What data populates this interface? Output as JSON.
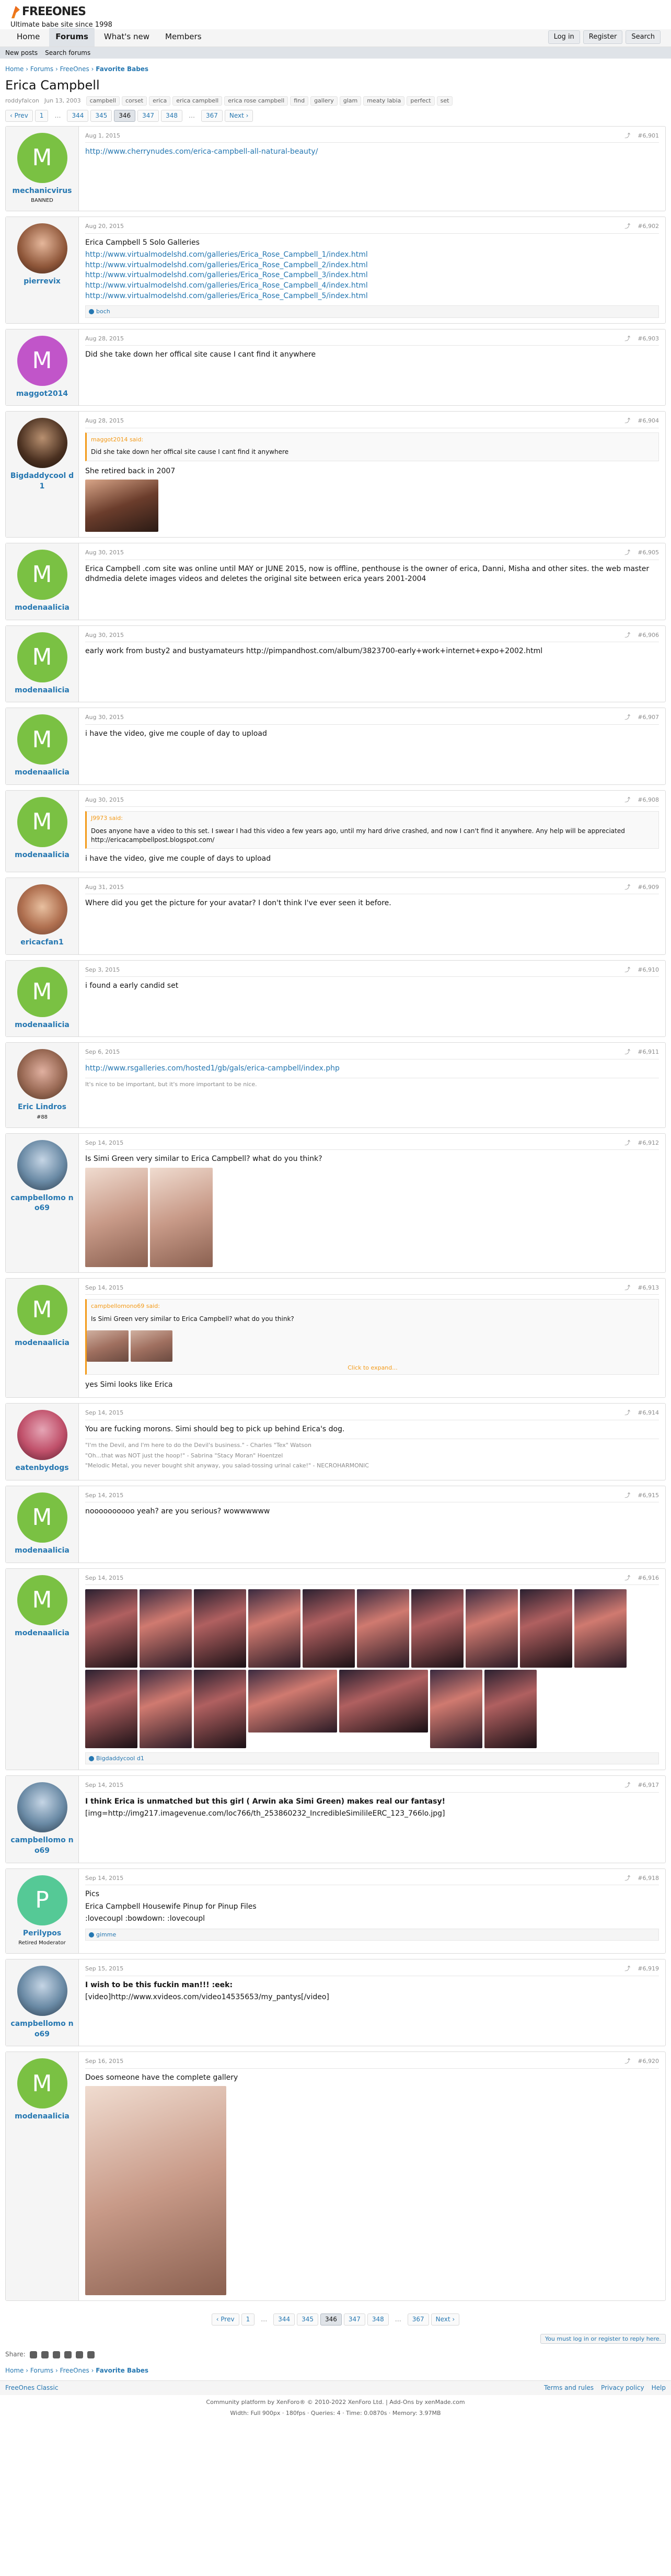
{
  "header": {
    "logo": "FREEONES",
    "tagline": "Ultimate babe site since 1998",
    "tabs": [
      "Home",
      "Forums",
      "What's new",
      "Members"
    ],
    "login": "Log in",
    "register": "Register",
    "search": "Search",
    "sub": [
      "New posts",
      "Search forums"
    ]
  },
  "breadcrumb": [
    "Home",
    "Forums",
    "FreeOnes",
    "Favorite Babes"
  ],
  "thread": {
    "title": "Erica Campbell",
    "author": "roddyfalcon",
    "date": "Jun 13, 2003",
    "tags": [
      "campbell",
      "corset",
      "erica",
      "erica campbell",
      "erica rose campbell",
      "find",
      "gallery",
      "glam",
      "meaty labia",
      "perfect",
      "set"
    ]
  },
  "pager": {
    "prev": "Prev",
    "pages": [
      "1",
      "…",
      "344",
      "345",
      "346",
      "347",
      "348",
      "…",
      "367"
    ],
    "current": "346",
    "next": "Next"
  },
  "posts": [
    {
      "user": "mechanicvirus",
      "title": "BANNED",
      "date": "Aug 1, 2015",
      "num": "#6,901",
      "body": [
        "http://www.cherrynudes.com/erica-campbell-all-natural-beauty/"
      ]
    },
    {
      "user": "pierrevix",
      "title": "",
      "date": "Aug 20, 2015",
      "num": "#6,902",
      "body": [
        "Erica Campbell 5 Solo Galleries",
        "http://www.virtualmodelshd.com/galleries/Erica_Rose_Campbell_1/index.html",
        "http://www.virtualmodelshd.com/galleries/Erica_Rose_Campbell_2/index.html",
        "http://www.virtualmodelshd.com/galleries/Erica_Rose_Campbell_3/index.html",
        "http://www.virtualmodelshd.com/galleries/Erica_Rose_Campbell_4/index.html",
        "http://www.virtualmodelshd.com/galleries/Erica_Rose_Campbell_5/index.html"
      ],
      "likes": "boch"
    },
    {
      "user": "maggot2014",
      "title": "",
      "date": "Aug 28, 2015",
      "num": "#6,903",
      "body": [
        "Did she take down her offical site cause I cant find it anywhere"
      ]
    },
    {
      "user": "Bigdaddycool d1",
      "title": "",
      "date": "Aug 28, 2015",
      "num": "#6,904",
      "quote": {
        "head": "maggot2014 said:",
        "body": "Did she take down her offical site cause I cant find it anywhere"
      },
      "body": [
        "She retired back in 2007"
      ]
    },
    {
      "user": "modenaalicia",
      "title": "",
      "date": "Aug 30, 2015",
      "num": "#6,905",
      "body": [
        "Erica Campbell .com site was online until MAY or JUNE 2015, now is offline, penthouse is the owner of erica, Danni, Misha and other sites. the web master dhdmedia delete images videos and deletes the original site between erica years 2001-2004"
      ]
    },
    {
      "user": "modenaalicia",
      "title": "",
      "date": "Aug 30, 2015",
      "num": "#6,906",
      "body": [
        "early work from busty2 and bustyamateurs http://pimpandhost.com/album/3823700-early+work+internet+expo+2002.html"
      ]
    },
    {
      "user": "modenaalicia",
      "title": "",
      "date": "Aug 30, 2015",
      "num": "#6,907",
      "body": [
        "i have the video, give me couple of day to upload"
      ]
    },
    {
      "user": "modenaalicia",
      "title": "",
      "date": "Aug 30, 2015",
      "num": "#6,908",
      "quote": {
        "head": "J9973 said:",
        "body": "Does anyone have a video to this set. I swear I had this video a few years ago, until my hard drive crashed, and now I can't find it anywhere. Any help will be appreciated http://ericacampbellpost.blogspot.com/"
      },
      "body": [
        "i have the video, give me couple of days to upload"
      ]
    },
    {
      "user": "ericacfan1",
      "title": "",
      "date": "Aug 31, 2015",
      "num": "#6,909",
      "body": [
        "Where did you get the picture for your avatar? I don't think I've ever seen it before."
      ]
    },
    {
      "user": "modenaalicia",
      "title": "",
      "date": "Sep 3, 2015",
      "num": "#6,910",
      "body": [
        "i found a early candid set"
      ]
    },
    {
      "user": "Eric Lindros",
      "title": "#88",
      "date": "Sep 6, 2015",
      "num": "#6,911",
      "body": [
        "http://www.rsgalleries.com/hosted1/gb/gals/erica-campbell/index.php"
      ],
      "sig": "It's nice to be important, but it's more important to be nice."
    },
    {
      "user": "campbellomo no69",
      "title": "",
      "date": "Sep 14, 2015",
      "num": "#6,912",
      "body": [
        "Is Simi Green very similar to Erica Campbell? what do you think?"
      ]
    },
    {
      "user": "modenaalicia",
      "title": "",
      "date": "Sep 14, 2015",
      "num": "#6,913",
      "quote": {
        "head": "campbellomono69 said:",
        "body": "Is Simi Green very similar to Erica Campbell? what do you think?"
      },
      "body": [
        "yes Simi looks like Erica"
      ],
      "expand": "Click to expand..."
    },
    {
      "user": "eatenbydogs",
      "title": "",
      "date": "Sep 14, 2015",
      "num": "#6,914",
      "body": [
        "You are fucking morons. Simi should beg to pick up behind Erica's dog."
      ],
      "sig2": [
        "\"I'm the Devil, and I'm here to do the Devil's business.\" - Charles \"Tex\" Watson",
        "\"Oh...that was NOT just the hoop!\" - Sabrina \"Stacy Moran\" Hoentzel",
        "\"Melodic Metal, you never bought shit anyway, you salad-tossing urinal cake!\" - NECROHARMONIC"
      ]
    },
    {
      "user": "modenaalicia",
      "title": "",
      "date": "Sep 14, 2015",
      "num": "#6,915",
      "body": [
        "noooooooooo yeah? are you serious? wowwwwww"
      ]
    },
    {
      "user": "modenaalicia",
      "title": "",
      "date": "Sep 14, 2015",
      "num": "#6,916",
      "body": [],
      "likes": "Bigdaddycool d1"
    },
    {
      "user": "campbellomo no69",
      "title": "",
      "date": "Sep 14, 2015",
      "num": "#6,917",
      "body": [
        "I think Erica is unmatched but this girl ( Arwin aka Simi Green) makes real our fantasy!",
        "[img=http://img217.imagevenue.com/loc766/th_253860232_IncredibleSimilileERC_123_766lo.jpg]"
      ]
    },
    {
      "user": "Perilypos",
      "title": "Retired Moderator",
      "date": "Sep 14, 2015",
      "num": "#6,918",
      "body": [
        "Pics",
        "Erica Campbell Housewife Pinup for Pinup Files",
        ":lovecoupl :bowdown: :lovecoupl"
      ],
      "likes": "gimme"
    },
    {
      "user": "campbellomo no69",
      "title": "",
      "date": "Sep 15, 2015",
      "num": "#6,919",
      "body": [
        "I wish to be this fuckin man!!! :eek:",
        "[video]http://www.xvideos.com/video14535653/my_pantys[/video]"
      ]
    },
    {
      "user": "modenaalicia",
      "title": "",
      "date": "Sep 16, 2015",
      "num": "#6,920",
      "body": [
        "Does someone have the complete gallery"
      ]
    }
  ],
  "footer": {
    "login_msg": "You must log in or register to reply here.",
    "share": "Share:",
    "links": [
      "Home",
      "Forums",
      "FreeOnes",
      "Favorite Babes"
    ],
    "classic": "FreeOnes Classic",
    "terms": "Terms and rules",
    "privacy": "Privacy policy",
    "help": "Help",
    "credit": "Community platform by XenForo® © 2010-2022 XenForo Ltd. | Add-Ons by xenMade.com",
    "stats": "Width: Full 900px · 180fps · Queries: 4 · Time: 0.0870s · Memory: 3.97MB"
  }
}
